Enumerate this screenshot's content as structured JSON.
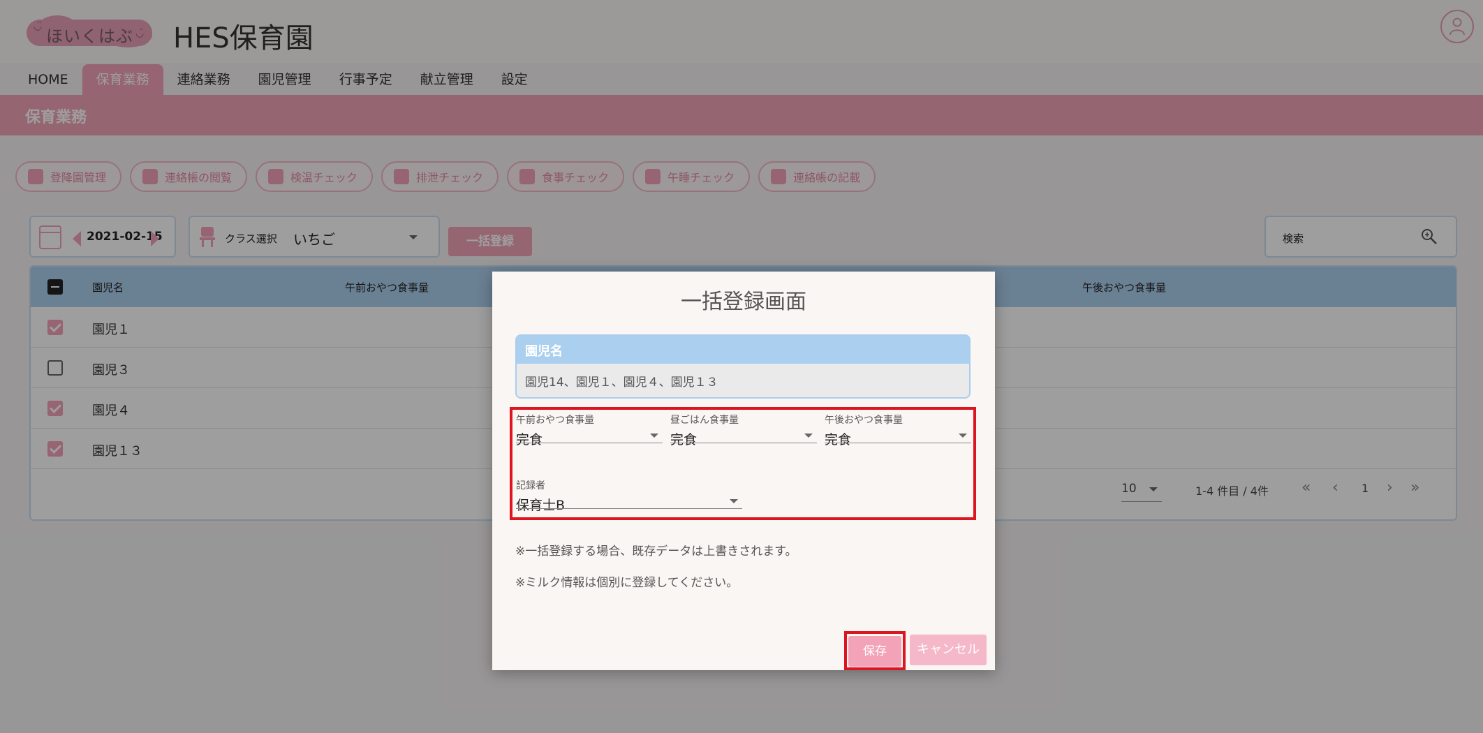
{
  "header": {
    "logo_text": "ほいくはぶ",
    "site_title": "HES保育園"
  },
  "nav": {
    "items": [
      {
        "label": "HOME"
      },
      {
        "label": "保育業務"
      },
      {
        "label": "連絡業務"
      },
      {
        "label": "園児管理"
      },
      {
        "label": "行事予定"
      },
      {
        "label": "献立管理"
      },
      {
        "label": "設定"
      }
    ],
    "active": "保育業務"
  },
  "banner": {
    "title": "保育業務"
  },
  "subnav": {
    "items": [
      {
        "label": "登降園管理"
      },
      {
        "label": "連絡帳の閲覧"
      },
      {
        "label": "検温チェック"
      },
      {
        "label": "排泄チェック"
      },
      {
        "label": "食事チェック"
      },
      {
        "label": "午睡チェック"
      },
      {
        "label": "連絡帳の記載"
      }
    ],
    "active": "食事チェック"
  },
  "controls": {
    "date": "2021-02-15",
    "class_label": "クラス選択",
    "class_value": "いちご",
    "bulk_button": "一括登録",
    "search_placeholder": "検索"
  },
  "table": {
    "columns": [
      "園児名",
      "午前おやつ食事量",
      "午後おやつ食事量"
    ],
    "rows": [
      {
        "name": "園児１",
        "checked": true
      },
      {
        "name": "園児３",
        "checked": false
      },
      {
        "name": "園児４",
        "checked": true
      },
      {
        "name": "園児１３",
        "checked": true
      }
    ],
    "pager": {
      "per_page": "10",
      "range": "1-4 件目 / 4件",
      "page": "1"
    }
  },
  "dialog": {
    "title": "一括登録画面",
    "names_label": "園児名",
    "names_value": "園児14、園児１、園児４、園児１３",
    "fields": {
      "am_snack": {
        "label": "午前おやつ食事量",
        "value": "完食"
      },
      "lunch": {
        "label": "昼ごはん食事量",
        "value": "完食"
      },
      "pm_snack": {
        "label": "午後おやつ食事量",
        "value": "完食"
      },
      "recorder": {
        "label": "記録者",
        "value": "保育士B"
      }
    },
    "notes": [
      "※一括登録する場合、既存データは上書きされます。",
      "※ミルク情報は個別に登録してください。"
    ],
    "save_label": "保存",
    "cancel_label": "キャンセル"
  },
  "colors": {
    "brand_pink": "#f3a3b8",
    "header_blue": "#abcfee",
    "highlight_red": "#dd1520"
  }
}
